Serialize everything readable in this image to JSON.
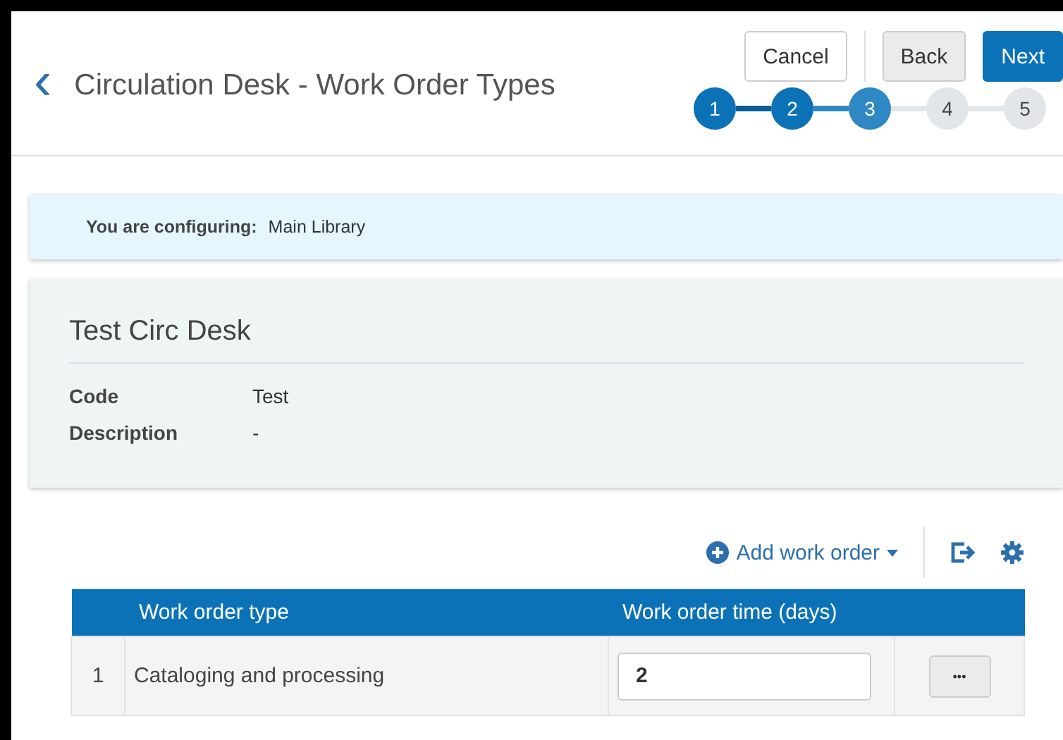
{
  "header": {
    "back_icon": "‹",
    "title": "Circulation Desk - Work Order Types"
  },
  "buttons": [
    {
      "label": "Cancel",
      "kind": "outline"
    },
    {
      "label": "Back",
      "kind": "grey"
    },
    {
      "label": "Next",
      "kind": "primary"
    }
  ],
  "steps": [
    {
      "label": "1",
      "completed": true,
      "selected": false
    },
    {
      "label": "2",
      "completed": true,
      "selected": false
    },
    {
      "label": "3",
      "completed": false,
      "selected": true
    },
    {
      "label": "4",
      "completed": false,
      "selected": false
    },
    {
      "label": "5",
      "completed": false,
      "selected": false
    }
  ],
  "info_bar": {
    "label": "You are configuring:",
    "value": "Main Library"
  },
  "desk": {
    "title": "Test Circ Desk",
    "fields": [
      {
        "label": "Code",
        "value": "Test"
      },
      {
        "label": "Description",
        "value": "-"
      }
    ]
  },
  "toolbar": {
    "add_label": "Add work order"
  },
  "table": {
    "columns": [
      "Work order type",
      "Work order time (days)"
    ],
    "rows": [
      {
        "index": "1",
        "type": "Cataloging and processing",
        "time": "2",
        "actions": "•••"
      }
    ]
  }
}
